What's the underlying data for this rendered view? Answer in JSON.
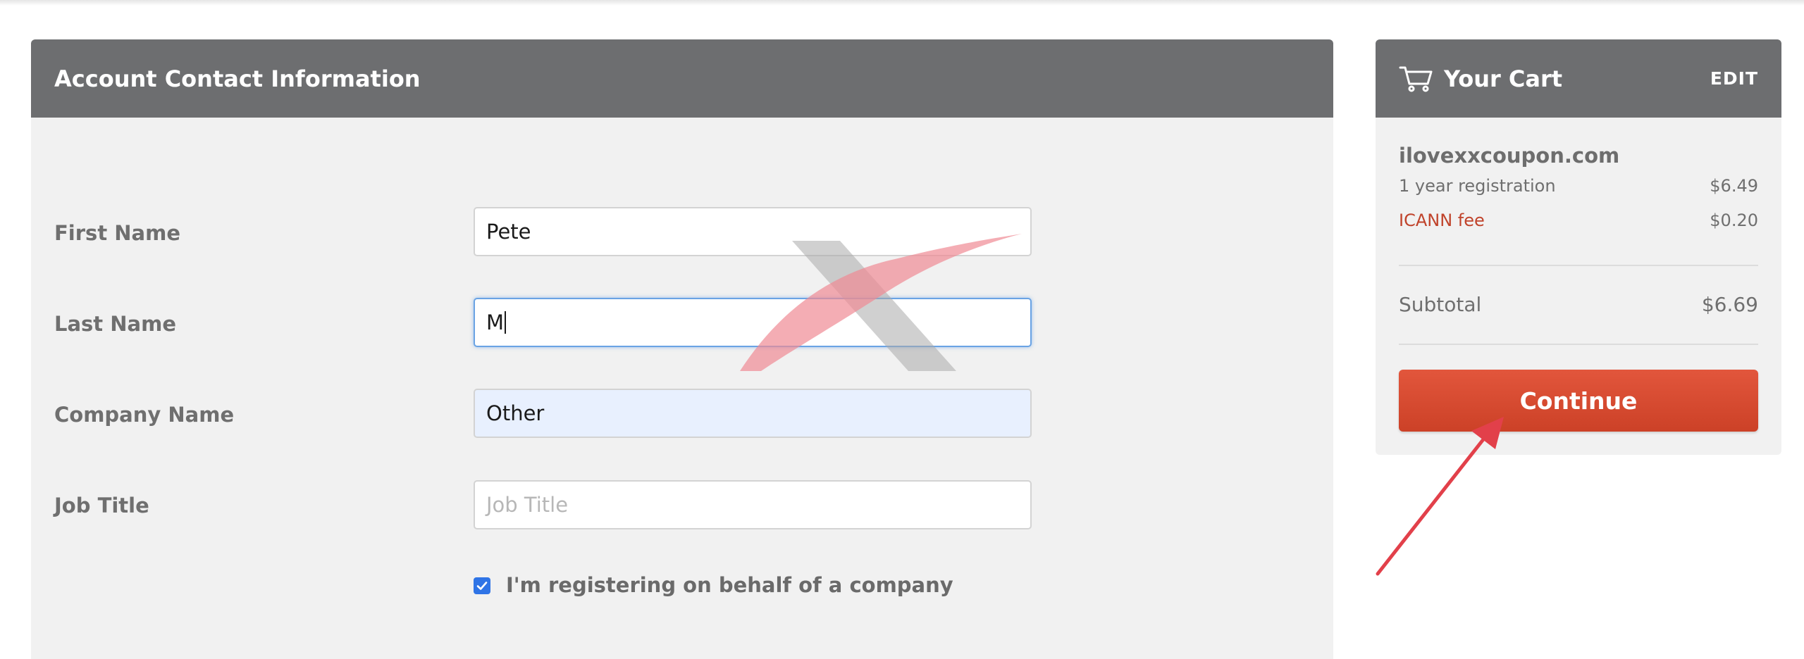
{
  "form": {
    "title": "Account Contact Information",
    "fields": [
      {
        "label": "First Name",
        "value": "Pete",
        "placeholder": ""
      },
      {
        "label": "Last Name",
        "value": "M",
        "placeholder": ""
      },
      {
        "label": "Company Name",
        "value": "Other",
        "placeholder": ""
      },
      {
        "label": "Job Title",
        "value": "",
        "placeholder": "Job Title"
      }
    ],
    "company_checkbox": {
      "checked": true,
      "label": "I'm registering on behalf of a company"
    }
  },
  "cart": {
    "title": "Your Cart",
    "edit_label": "EDIT",
    "domain": "ilovexxcoupon.com",
    "items": [
      {
        "label": "1 year registration",
        "amount": "$6.49"
      },
      {
        "label": "ICANN fee",
        "amount": "$0.20"
      }
    ],
    "subtotal_label": "Subtotal",
    "subtotal_amount": "$6.69",
    "continue_label": "Continue"
  },
  "colors": {
    "header_bg": "#6d6e70",
    "panel_bg": "#f1f1f1",
    "accent_button": "#d94b31",
    "fee_text": "#c0432b",
    "checkbox": "#2f74e6",
    "annotation_arrow": "#e2404a"
  },
  "icons": [
    "cart-icon",
    "check-icon"
  ]
}
